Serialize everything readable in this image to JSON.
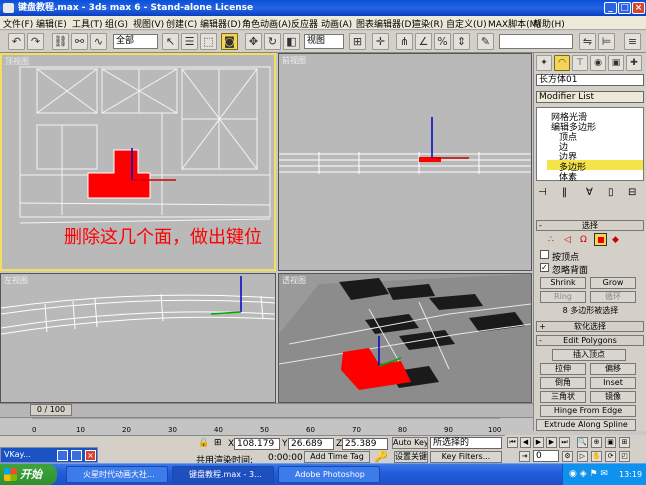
{
  "window": {
    "title": "键盘教程.max - 3ds max 6 - Stand-alone License",
    "min": "_",
    "max": "□",
    "close": "×"
  },
  "menu": [
    "文件(F)",
    "编辑(E)",
    "工具(T)",
    "组(G)",
    "视图(V)",
    "创建(C)",
    "编辑器(D)",
    "角色动画(A)",
    "反应器",
    "图形编辑器(D)",
    "动画(A)",
    "图表编辑器(D)",
    "渲染(R)",
    "自定义(U)",
    "MAX脚本(M)",
    "帮助(H)"
  ],
  "toolbar": {
    "selection_filter": "全部",
    "ref_coord": "视图",
    "named_sel": ""
  },
  "viewports": {
    "top": {
      "label": "顶视图"
    },
    "front": {
      "label": "前视图"
    },
    "left": {
      "label": "左视图"
    },
    "persp": {
      "label": "透视图"
    }
  },
  "annotation": "删除这几个面，做出键位",
  "command_panel": {
    "object_name": "长方体01",
    "modifier_list": "Modifier List",
    "stack": [
      "网格光滑",
      "编辑多边形",
      "顶点",
      "边",
      "边界",
      "多边形",
      "体素"
    ],
    "selected_stack_item": "多边形",
    "rollout_select": "选择",
    "by_vertex": "按顶点",
    "ignore_backface": "忽略背面",
    "shrink": "Shrink",
    "grow": "Grow",
    "ring": "Ring",
    "loop": "循环",
    "selected_info": "8 多边形被选择",
    "rollout_soft": "软化选择",
    "rollout_edit": "Edit Polygons",
    "insert_vertex": "插入顶点",
    "extrude": "拉伸",
    "outline": "偏移",
    "bevel": "倒角",
    "inset": "Inset",
    "triangulate": "三角状",
    "flip": "镜像",
    "hinge": "Hinge From Edge",
    "extrude_spline": "Extrude Along Spline"
  },
  "timeline": {
    "frame": "0 / 100",
    "ticks": [
      "0",
      "10",
      "20",
      "30",
      "40",
      "50",
      "60",
      "70",
      "80",
      "90",
      "100"
    ]
  },
  "status": {
    "x_label": "X",
    "x": "108.179",
    "y_label": "Y",
    "y": "26.689",
    "z_label": "Z",
    "z": "25.389",
    "auto_key": "Auto Key",
    "selected": "所选择的",
    "render_time": "共用渲染时间:",
    "time_val": "0:00:00",
    "add_time_tag": "Add Time Tag",
    "set_key": "设置关键",
    "key_filters": "Key Filters...",
    "frame_field": "0"
  },
  "taskbar": {
    "start": "开始",
    "vkay": "VKay...",
    "tasks": [
      "火星时代动画大社...",
      "键盘教程.max - 3...",
      "Adobe Photoshop"
    ],
    "clock": "13:19"
  }
}
